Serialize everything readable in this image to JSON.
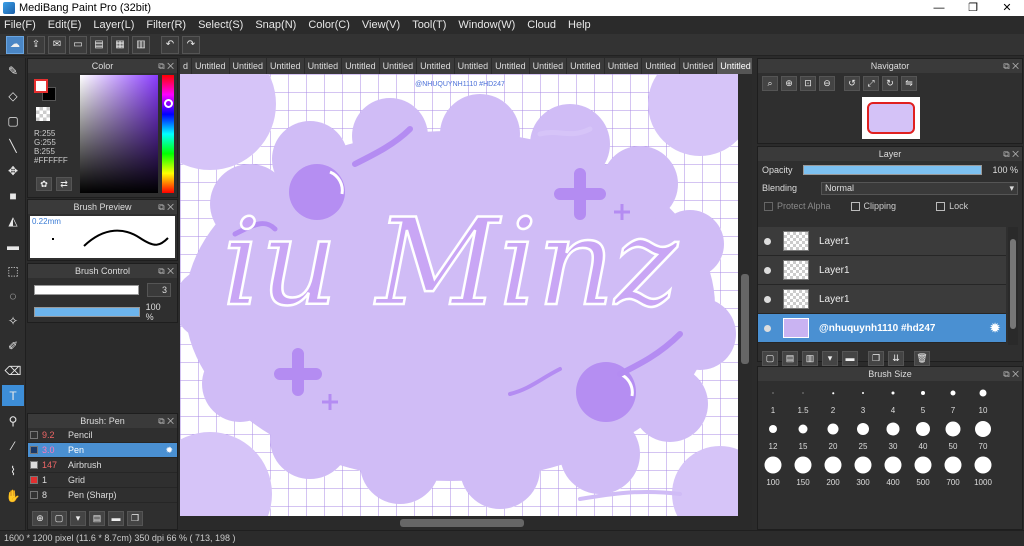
{
  "window": {
    "title": "MediBang Paint Pro (32bit)",
    "minimize": "—",
    "maximize": "❐",
    "close": "✕"
  },
  "menu": [
    "File(F)",
    "Edit(E)",
    "Layer(L)",
    "Filter(R)",
    "Select(S)",
    "Snap(N)",
    "Color(C)",
    "View(V)",
    "Tool(T)",
    "Window(W)",
    "Cloud",
    "Help"
  ],
  "panels": {
    "color": {
      "title": "Color",
      "r": "R:255",
      "g": "G:255",
      "b": "B:255",
      "hex": "#FFFFFF"
    },
    "brush_preview": {
      "title": "Brush Preview",
      "size": "0.22mm"
    },
    "brush_control": {
      "title": "Brush Control",
      "size_value": "3",
      "opacity_value": "100 %",
      "size_fill": 0.0,
      "opacity_fill": 1.0
    },
    "brush_list": {
      "title": "Brush: Pen",
      "items": [
        {
          "size": "9.2",
          "name": "Pencil",
          "chip": "#333333"
        },
        {
          "size": "3.0",
          "name": "Pen",
          "chip": "#1a3a6a"
        },
        {
          "size": "147",
          "name": "Airbrush",
          "chip": "#dddddd"
        },
        {
          "size": "1",
          "name": "Grid",
          "chip": "#e03030"
        },
        {
          "size": "8",
          "name": "Pen (Sharp)",
          "chip": "#333333"
        }
      ]
    },
    "navigator": {
      "title": "Navigator"
    },
    "layer": {
      "title": "Layer",
      "opacity_label": "Opacity",
      "opacity_value": "100 %",
      "blending_label": "Blending",
      "blending_value": "Normal",
      "protect_alpha": "Protect Alpha",
      "clipping": "Clipping",
      "lock": "Lock",
      "layers": [
        {
          "name": "Layer1"
        },
        {
          "name": "Layer1"
        },
        {
          "name": "Layer1"
        },
        {
          "name": "@nhuquynh1110 #hd247"
        }
      ]
    },
    "brush_size": {
      "title": "Brush Size",
      "sizes": [
        "1",
        "1.5",
        "2",
        "3",
        "4",
        "5",
        "7",
        "10",
        "12",
        "15",
        "20",
        "25",
        "30",
        "40",
        "50",
        "70",
        "100",
        "150",
        "200",
        "300",
        "400",
        "500",
        "700",
        "1000"
      ]
    }
  },
  "tabs": [
    "Untitled",
    "Untitled",
    "Untitled",
    "Untitled",
    "Untitled",
    "Untitled",
    "Untitled",
    "Untitled",
    "Untitled",
    "Untitled",
    "Untitled",
    "Untitled",
    "Untitled",
    "Untitled",
    "Untitled"
  ],
  "tab_partial": "d",
  "canvas": {
    "watermark": "@NHUQUYNH1110 #HD247",
    "lettering": "iu Minz"
  },
  "status": {
    "text": "1600 * 1200 pixel   (11.6 * 8.7cm)   350 dpi   66 %   ( 713, 198 )"
  },
  "colors": {
    "accent": "#4a90d2",
    "canvas_bg": "#c9b3f2",
    "grid": "#a98ae6"
  }
}
